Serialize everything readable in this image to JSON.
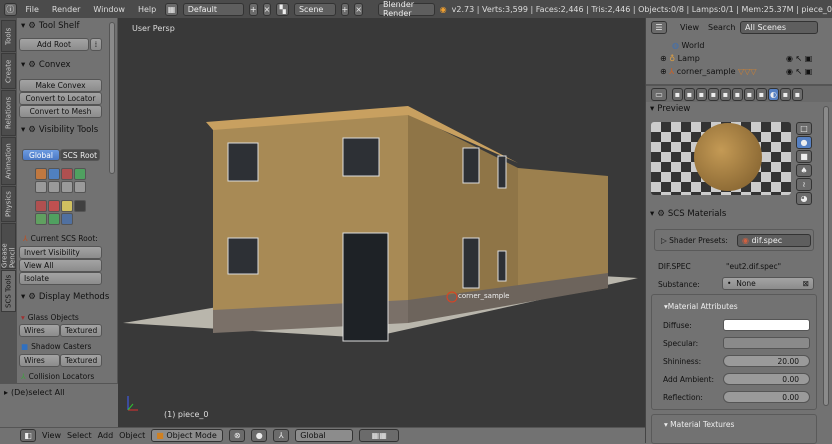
{
  "topbar": {
    "menus": [
      "File",
      "Render",
      "Window",
      "Help"
    ],
    "layout": "Default",
    "scene": "Scene",
    "engine": "Blender Render",
    "stats": "v2.73 | Verts:3,599 | Faces:2,446 | Tris:2,446 | Objects:0/8 | Lamps:0/1 | Mem:25.37M | piece_0"
  },
  "tabs": [
    "Tools",
    "Create",
    "Relations",
    "Animation",
    "Physics",
    "Grease Pencil",
    "SCS Tools"
  ],
  "shelf": {
    "tool_shelf": "Tool Shelf",
    "add_root": "Add Root",
    "convex": "Convex",
    "make_convex": "Make Convex",
    "convert_locator": "Convert to Locator",
    "convert_mesh": "Convert to Mesh",
    "visibility_tools": "Visibility Tools",
    "global": "Global",
    "scs_root": "SCS Root",
    "current_root": "Current SCS Root:",
    "invert": "Invert Visibility",
    "view_all": "View All",
    "isolate": "Isolate",
    "display_methods": "Display Methods",
    "glass": "Glass Objects",
    "wires": "Wires",
    "textured": "Textured",
    "shadow": "Shadow Casters",
    "collision": "Collision Locators",
    "deselect": "(De)select All"
  },
  "viewport": {
    "label": "User Persp",
    "object_label": "(1) piece_0",
    "origin_label": "corner_sample"
  },
  "bottombar": {
    "menus": [
      "View",
      "Select",
      "Add",
      "Object"
    ],
    "mode": "Object Mode",
    "orientation": "Global"
  },
  "outliner": {
    "view": "View",
    "search": "Search",
    "scenes": "All Scenes",
    "items": [
      "World",
      "Lamp",
      "corner_sample"
    ]
  },
  "props": {
    "preview": "Preview",
    "scs_materials": "SCS Materials",
    "shader_presets_label": "Shader Presets:",
    "shader_preset": "dif.spec",
    "shader_name": "DIF.SPEC",
    "shader_file": "\"eut2.dif.spec\"",
    "substance_label": "Substance:",
    "substance": "None",
    "attributes": "Material Attributes",
    "diffuse": "Diffuse:",
    "specular": "Specular:",
    "shininess": "Shininess:",
    "shininess_val": "20.00",
    "ambient": "Add Ambient:",
    "ambient_val": "0.00",
    "reflection": "Reflection:",
    "reflection_val": "0.00",
    "textures": "Material Textures"
  }
}
